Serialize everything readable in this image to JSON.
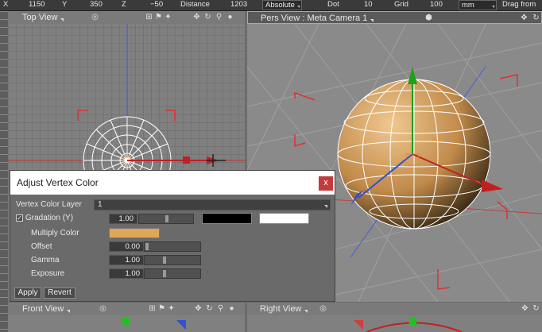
{
  "toolbar": {
    "x_label": "X",
    "x_value": "1150",
    "y_label": "Y",
    "y_value": "350",
    "z_label": "Z",
    "z_value": "−50",
    "distance_label": "Distance",
    "distance_value": "1203",
    "mode_select": "Absolute",
    "dot_label": "Dot",
    "dot_value": "10",
    "grid_label": "Grid",
    "grid_value": "100",
    "unit_select": "mm",
    "drag_label": "Drag from"
  },
  "viewports": {
    "top": "Top View",
    "perspective": "Pers View : Meta Camera 1",
    "front": "Front View",
    "right": "Right View"
  },
  "dialog": {
    "title": "Adjust Vertex Color",
    "close": "x",
    "layer_label": "Vertex Color Layer",
    "layer_value": "1",
    "gradation_label": "Gradation (Y)",
    "gradation_value": "1.00",
    "gradation_checked": true,
    "gradation_start_color": "#000000",
    "gradation_end_color": "#ffffff",
    "multiply_label": "Multiply Color",
    "multiply_color": "#e0a659",
    "offset_label": "Offset",
    "offset_value": "0.00",
    "gamma_label": "Gamma",
    "gamma_value": "1.00",
    "exposure_label": "Exposure",
    "exposure_value": "1.00",
    "apply": "Apply",
    "revert": "Revert"
  },
  "colors": {
    "accent_selection": "#e03030",
    "axis_x": "#d02020",
    "axis_y": "#20c020",
    "axis_z": "#3050d0",
    "sphere": "#c08a4a"
  }
}
